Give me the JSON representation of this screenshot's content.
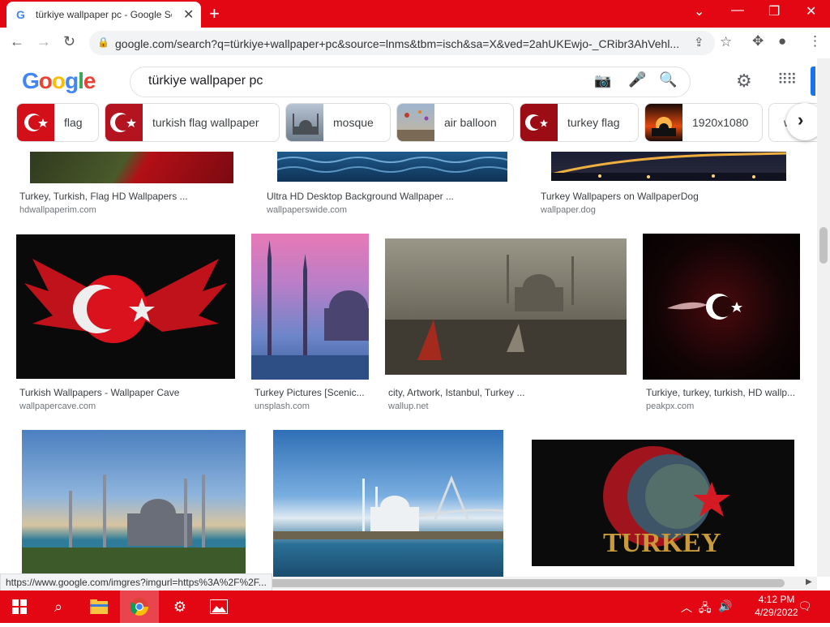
{
  "browser": {
    "tab_title": "türkiye wallpaper pc - Google Se",
    "tab_favicon": "G",
    "url": "google.com/search?q=türkiye+wallpaper+pc&source=lnms&tbm=isch&sa=X&ved=2ahUKEwjo-_CRibr3AhVehl..."
  },
  "google": {
    "logo_text": "Google",
    "query": "türkiye wallpaper pc"
  },
  "chips": [
    {
      "label": "flag",
      "color": "#d3101a"
    },
    {
      "label": "turkish flag wallpaper",
      "color": "#b3141f"
    },
    {
      "label": "mosque",
      "color": "#7d8a99"
    },
    {
      "label": "air balloon",
      "color": "#8aa4c0"
    },
    {
      "label": "turkey flag",
      "color": "#9c0c14"
    },
    {
      "label": "1920x1080",
      "color": "#e24a0f"
    },
    {
      "label": "w",
      "color": "#ffffff"
    }
  ],
  "results": {
    "row1": [
      {
        "caption": "Turkey, Turkish, Flag HD Wallpapers ...",
        "source": "hdwallpaperim.com"
      },
      {
        "caption": "Ultra HD Desktop Background Wallpaper ...",
        "source": "wallpaperswide.com"
      },
      {
        "caption": "Turkey Wallpapers on WallpaperDog",
        "source": "wallpaper.dog"
      }
    ],
    "row2": [
      {
        "caption": "Turkish Wallpapers - Wallpaper Cave",
        "source": "wallpapercave.com"
      },
      {
        "caption": "Turkey Pictures [Scenic...",
        "source": "unsplash.com"
      },
      {
        "caption": "city, Artwork, Istanbul, Turkey ...",
        "source": "wallup.net"
      },
      {
        "caption": "Turkiye, turkey, turkish, HD wallp...",
        "source": "peakpx.com"
      }
    ],
    "row3_overlay_text": "TURKEY"
  },
  "status_url": "https://www.google.com/imgres?imgurl=https%3A%2F%2F...",
  "taskbar": {
    "time": "4:12 PM",
    "date": "4/29/2022"
  }
}
